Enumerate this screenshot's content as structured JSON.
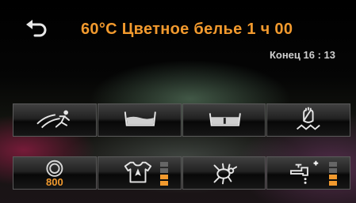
{
  "header": {
    "back_icon": "back-arrow-icon",
    "program_title": "60°C Цветное белье  1 ч 00",
    "end_time": "Конец 16 : 13"
  },
  "colors": {
    "accent": "#f29a2e",
    "text": "#cfcfcf",
    "inactive_level": "#666666"
  },
  "options_row_1": [
    {
      "icon": "quick-wash-runner-icon"
    },
    {
      "icon": "water-plus-icon"
    },
    {
      "icon": "intensive-tub-icon"
    },
    {
      "icon": "hand-wash-icon"
    }
  ],
  "options_row_2": [
    {
      "icon": "spin-icon",
      "value": "800"
    },
    {
      "icon": "tshirt-soil-icon",
      "level": 2,
      "levels": 4
    },
    {
      "icon": "allergy-mite-icon"
    },
    {
      "icon": "extra-rinse-icon",
      "level": 2,
      "levels": 4
    }
  ]
}
